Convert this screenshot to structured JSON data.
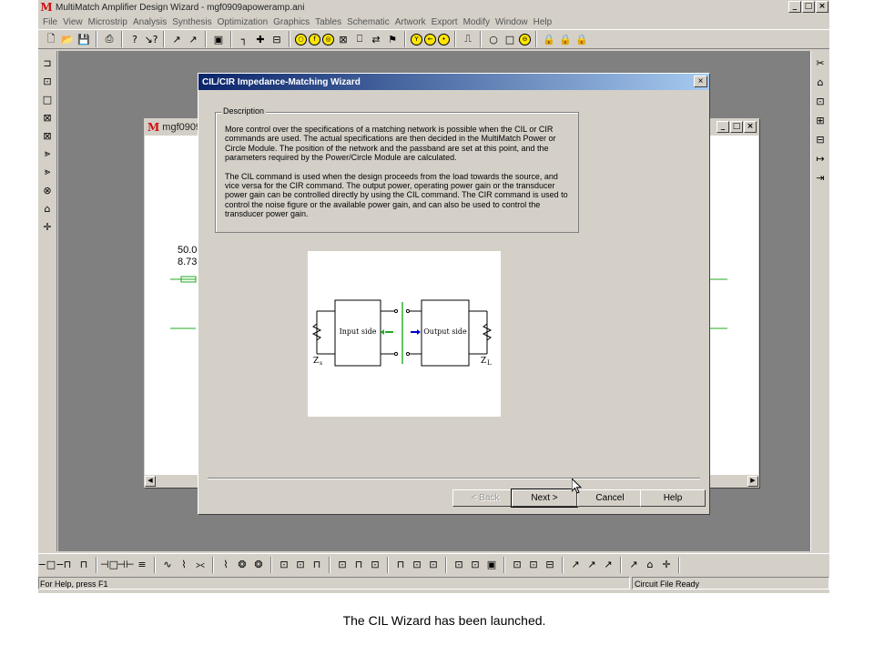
{
  "app": {
    "title": "MultiMatch Amplifier Design Wizard - mgf0909apoweramp.ani",
    "logo_glyph": "M",
    "logo_color": "#d01010",
    "window_buttons": [
      "_",
      "□",
      "×"
    ]
  },
  "menu": [
    "File",
    "View",
    "Microstrip",
    "Analysis",
    "Synthesis",
    "Optimization",
    "Graphics",
    "Tables",
    "Schematic",
    "Artwork",
    "Export",
    "Modify",
    "Window",
    "Help"
  ],
  "toolbar_icons": [
    {
      "name": "new-file-icon",
      "glyph": "🗋"
    },
    {
      "name": "open-folder-icon",
      "glyph": "📂"
    },
    {
      "name": "save-icon",
      "glyph": "💾"
    },
    {
      "name": "print-icon",
      "glyph": "⎙"
    },
    {
      "name": "help-icon",
      "glyph": "?"
    },
    {
      "name": "context-help-icon",
      "glyph": "↘?"
    },
    {
      "name": "draw-line-icon",
      "glyph": "↗"
    },
    {
      "name": "draw-line-2-icon",
      "glyph": "↗"
    },
    {
      "name": "component-icon",
      "glyph": "▣"
    },
    {
      "name": "tee-icon",
      "glyph": "┐"
    },
    {
      "name": "cross-icon",
      "glyph": "✚"
    },
    {
      "name": "box-icon",
      "glyph": "⊟"
    },
    {
      "name": "circle-icon",
      "glyph": "○"
    },
    {
      "name": "frequency-icon",
      "glyph": "f"
    },
    {
      "name": "target-icon",
      "glyph": "◎"
    },
    {
      "name": "xbox-icon",
      "glyph": "⊠"
    },
    {
      "name": "network-icon",
      "glyph": "⎕"
    },
    {
      "name": "parallel-icon",
      "glyph": "⇄"
    },
    {
      "name": "flag-icon",
      "glyph": "⚑"
    },
    {
      "name": "yellow-y-icon",
      "glyph": "Y"
    },
    {
      "name": "yellow-back-icon",
      "glyph": "←"
    },
    {
      "name": "yellow-dot-icon",
      "glyph": "•"
    },
    {
      "name": "filter-icon",
      "glyph": "⎍"
    },
    {
      "name": "ring-icon",
      "glyph": "○"
    },
    {
      "name": "square-icon",
      "glyph": "□"
    },
    {
      "name": "minus-circle-icon",
      "glyph": "⊖"
    },
    {
      "name": "lock-icon",
      "glyph": "🔒"
    },
    {
      "name": "lock-2-icon",
      "glyph": "🔒"
    },
    {
      "name": "lock-3-icon",
      "glyph": "🔒"
    }
  ],
  "left_icons": [
    "⊐",
    "⊡",
    "□",
    "⊠",
    "⊠",
    "⪢",
    "⪢",
    "⊗",
    "⌂",
    "✛"
  ],
  "right_icons": [
    "✂",
    "⌂",
    "⊡",
    "⊞",
    "⊟",
    "↦",
    "⇥"
  ],
  "child_window": {
    "title": "mgf0909",
    "text_line1": "50.0",
    "text_line2": "8.73"
  },
  "dialog": {
    "title": "CIL/CIR Impedance-Matching Wizard",
    "close": "×",
    "group_label": "Description",
    "paragraph1": "More control over the specifications of a matching network is possible when the CIL or CIR commands are used. The actual specifications are then decided in the MultiMatch Power or Circle Module. The position of the network and the passband are set at this point, and the parameters required by the Power/Circle Module are calculated.",
    "paragraph2": "The CIL command is used when the design proceeds from the load towards the source, and vice versa for the CIR command. The output power, operating power gain or the transducer power gain can be controlled directly by using the CIL command. The CIR command is used to control the noise figure or the available power gain, and can also be used to control the transducer power gain.",
    "diagram": {
      "input_label": "Input side",
      "output_label": "Output side",
      "zs_label": "Z",
      "zs_sub": "s",
      "zl_label": "Z",
      "zl_sub": "L",
      "left_arrow_color": "#22aa22",
      "right_arrow_color": "#0000cc",
      "divider_color": "#22aa22"
    },
    "buttons": {
      "back": "< Back",
      "next": "Next >",
      "cancel": "Cancel",
      "help": "Help"
    }
  },
  "bottom_icons": [
    "−□−",
    "⊓",
    "⊓",
    "⊣□",
    "⊣⊢",
    "≡",
    "∿",
    "⌇",
    "⪥",
    "⌇",
    "❂",
    "❂",
    "⊡",
    "⊡",
    "⊓",
    "⊡",
    "⊓",
    "⊡",
    "⊓",
    "⊡",
    "⊡",
    "⊡",
    "⊡",
    "▣",
    "⊡",
    "⊡",
    "⊟",
    "↗",
    "↗",
    "↗",
    "↗",
    "⌂",
    "✛"
  ],
  "status": {
    "help": "For Help, press F1",
    "state": "Circuit File Ready"
  },
  "caption": "The CIL Wizard has been launched."
}
